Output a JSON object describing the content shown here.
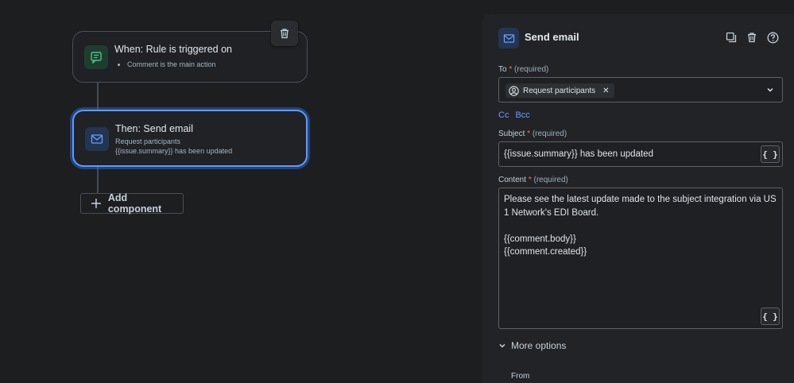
{
  "canvas": {
    "trigger_card": {
      "title": "When: Rule is triggered on",
      "detail": "Comment is the main action"
    },
    "action_card": {
      "title": "Then: Send email",
      "line1": "Request participants",
      "line2": "{{issue.summary}} has been updated"
    },
    "add_component_label": "Add component"
  },
  "panel": {
    "title": "Send email",
    "to": {
      "label": "To",
      "required_mark": "*",
      "hint": "(required)",
      "chip_label": "Request participants"
    },
    "cc_label": "Cc",
    "bcc_label": "Bcc",
    "subject": {
      "label": "Subject",
      "required_mark": "*",
      "hint": "(required)",
      "value": "{{issue.summary}} has been updated"
    },
    "content": {
      "label": "Content",
      "required_mark": "*",
      "hint": "(required)",
      "lines": [
        "Please see the latest update made to the subject integration via US",
        "1 Network's EDI Board.",
        "",
        "{{comment.body}}",
        "{{comment.created}}"
      ]
    },
    "more_options_label": "More options",
    "from_label": "From",
    "smart_value_button": "{ }"
  },
  "colors": {
    "accent_blue": "#5b9cff",
    "link_blue": "#6c9dff",
    "required_red": "#f87168",
    "trigger_green": "#4cc38a"
  }
}
